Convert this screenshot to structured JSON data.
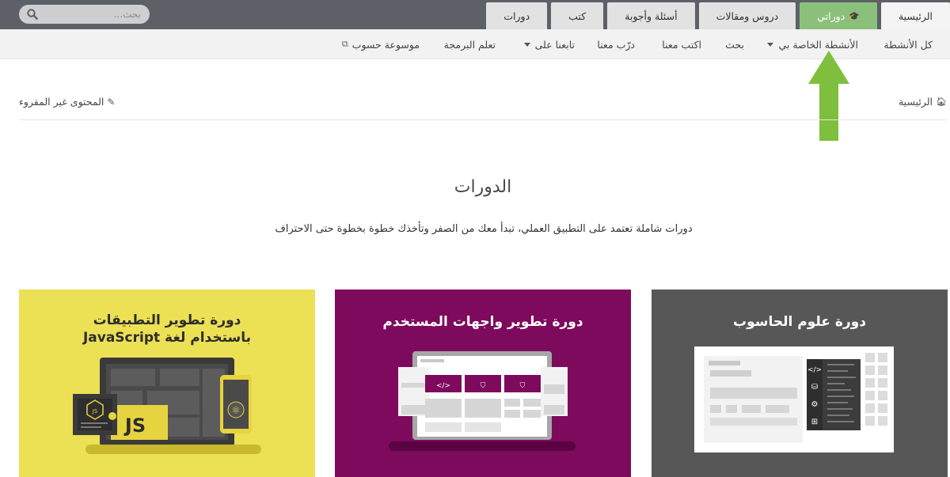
{
  "top_tabs": [
    {
      "label": "الرئيسية",
      "state": "active"
    },
    {
      "label": "دوراتي",
      "state": "highlight",
      "icon": "graduation-cap-icon"
    },
    {
      "label": "دروس ومقالات",
      "state": "normal"
    },
    {
      "label": "أسئلة وأجوبة",
      "state": "normal"
    },
    {
      "label": "كتب",
      "state": "normal"
    },
    {
      "label": "دورات",
      "state": "normal"
    }
  ],
  "search": {
    "placeholder": "بحث...",
    "icon": "search-icon"
  },
  "subnav": {
    "all_activities": "كل الأنشطة",
    "my_activities": "الأنشطة الخاصة بي",
    "search": "بحث",
    "write_with_us": "اكتب معنا",
    "train_with_us": "درّب معنا",
    "follow_us": "تابعنا على",
    "learn_programming": "تعلم البرمجة",
    "encyclopedia": "موسوعة حسوب"
  },
  "breadcrumb": {
    "home": "الرئيسية",
    "home_icon": "home-icon",
    "unread": "المحتوى غير المقروء",
    "unread_icon": "magic-wand-icon"
  },
  "page": {
    "title": "الدورات",
    "description": "دورات شاملة تعتمد على التطبيق العملي، تبدأ معك من الصفر وتأخذك خطوة بخطوة حتى الاحتراف"
  },
  "courses": [
    {
      "title": "دورة علوم الحاسوب",
      "color": "#575757"
    },
    {
      "title": "دورة تطوير واجهات المستخدم",
      "color": "#7e0a5d"
    },
    {
      "title_line1": "دورة تطوير التطبيقات",
      "title_line2": "باستخدام لغة JavaScript",
      "color": "#ece054",
      "badge": "JS"
    }
  ],
  "colors": {
    "topbar": "#5d6067",
    "highlight_tab": "#8bc07a",
    "arrow": "#7fbf3e"
  }
}
